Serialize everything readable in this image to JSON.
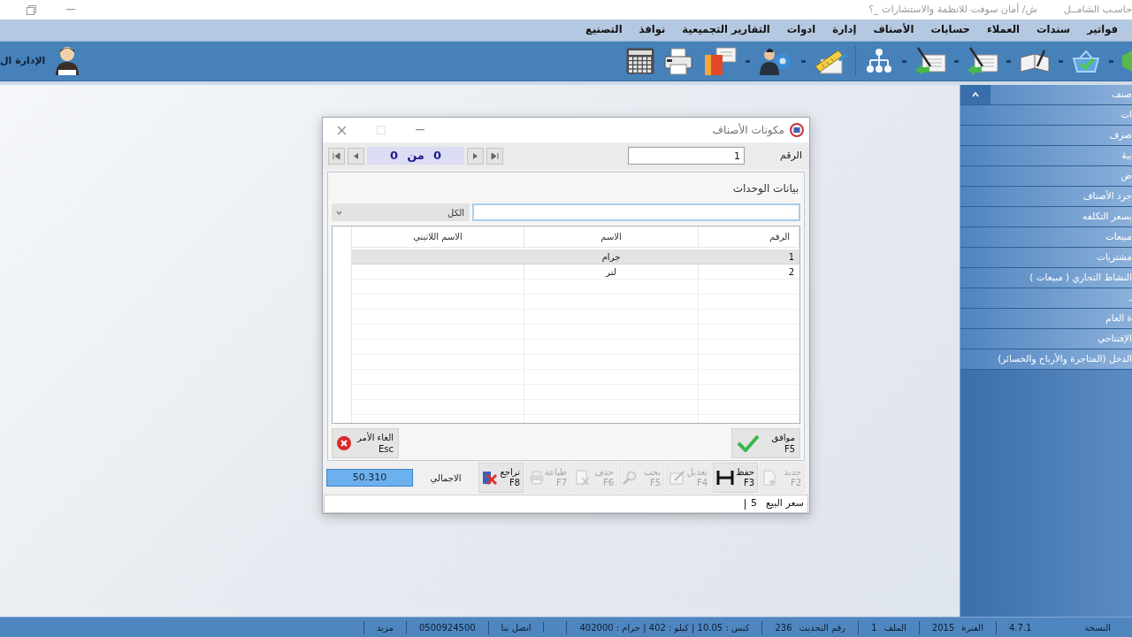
{
  "window": {
    "app_title": "حاسـب الشامــل",
    "company_title": "ش/ أمان سوفت للانظمة والاستشارات _؟"
  },
  "menu": [
    "فواتير",
    "سندات",
    "العملاء",
    "حسابات",
    "الأصناف",
    "إدارة",
    "ادوات",
    "التقارير التجميعية",
    "نوافذ",
    "التصنيع"
  ],
  "user": {
    "label": "الإدارة ال"
  },
  "sidebar": {
    "items": [
      {
        "label": "صنف"
      },
      {
        "label": "ات"
      },
      {
        "label": "صرف"
      },
      {
        "label": "بية"
      },
      {
        "label": "ض"
      },
      {
        "label": "جرد الأصناف"
      },
      {
        "label": "بسعر التكلفه"
      },
      {
        "label": "مبيعات"
      },
      {
        "label": "مشتريات"
      },
      {
        "label": "النشاط التجاري ( مبيعات )"
      },
      {
        "label": "ـ"
      },
      {
        "label": "ة العام"
      },
      {
        "label": "الإفتتاحي"
      },
      {
        "label": "الدخل (المتاجرة والأرباح والخسائر)"
      }
    ]
  },
  "dialog": {
    "title": "مكونات الأصناف",
    "number": {
      "label": "الرقم",
      "value": "1"
    },
    "counter": {
      "current": "0",
      "separator": "من",
      "total": "0"
    },
    "section_title": "بيانات الوحدات",
    "filter": {
      "value": "الكل"
    },
    "grid": {
      "columns": [
        "الرقم",
        "الاسم",
        "الاسم اللاتيني"
      ],
      "rows": [
        {
          "number": "1",
          "name": "جرام",
          "selected": true
        },
        {
          "number": "2",
          "name": "لتر",
          "selected": false
        }
      ]
    },
    "actions": [
      {
        "kind": "ok",
        "label": "موافق",
        "key": "F5"
      },
      {
        "kind": "cancel",
        "label": "الغاء الأمر",
        "key": "Esc"
      }
    ],
    "tools": [
      {
        "kind": "new",
        "label": "جديد",
        "key": "F2",
        "disabled": true
      },
      {
        "kind": "save",
        "label": "حفظ",
        "key": "F3",
        "disabled": false
      },
      {
        "kind": "edit",
        "label": "تعديل",
        "key": "F4",
        "disabled": true
      },
      {
        "kind": "search",
        "label": "بحث",
        "key": "F5",
        "disabled": true
      },
      {
        "kind": "delete",
        "label": "حذف",
        "key": "F6",
        "disabled": true
      },
      {
        "kind": "print",
        "label": "طباعة",
        "key": "F7",
        "disabled": true
      },
      {
        "kind": "undo",
        "label": "تراجع",
        "key": "F8",
        "disabled": false
      }
    ],
    "total": {
      "label": "الاجمالي",
      "value": "50.310"
    },
    "status": {
      "label": "سعر البيع",
      "value": "5"
    }
  },
  "status_bar": [
    {
      "label": "النسخة",
      "value": "4.7.1"
    },
    {
      "label": "الفترة",
      "value": "2015"
    },
    {
      "label": "الملف",
      "value": "1"
    },
    {
      "label": "رقم التحديث",
      "value": "236"
    },
    {
      "text": "كيس : 10.05 | كيلو : 402 | جرام : 402000"
    },
    {
      "text": "اتصل بنا"
    },
    {
      "text": "0500924500"
    },
    {
      "text": "مزيد"
    }
  ]
}
